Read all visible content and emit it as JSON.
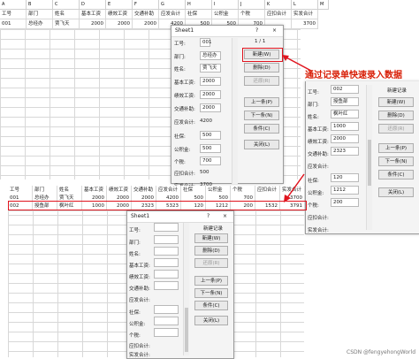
{
  "top_sheet": {
    "columns": [
      "A",
      "B",
      "C",
      "D",
      "E",
      "F",
      "G",
      "H",
      "I",
      "J",
      "K",
      "L",
      "M"
    ],
    "headers": [
      "工号",
      "部门",
      "姓名",
      "基本工资",
      "绩效工资",
      "交通补助",
      "应发合计",
      "社保",
      "公积金",
      "个税",
      "应扣合计",
      "实发合计"
    ],
    "row1": [
      "001",
      "总经办",
      "贾飞天",
      "2000",
      "2000",
      "2000",
      "4200",
      "500",
      "500",
      "700",
      "",
      "3700"
    ]
  },
  "bottom_sheet": {
    "headers": [
      "工号",
      "部门",
      "姓名",
      "基本工资",
      "绩效工资",
      "交通补助",
      "应发合计",
      "社保",
      "公积金",
      "个税",
      "应扣合计",
      "实发合计"
    ],
    "row1": [
      "001",
      "总经办",
      "贾飞天",
      "2000",
      "2000",
      "2000",
      "4200",
      "500",
      "500",
      "700",
      "",
      "3700"
    ],
    "row2": [
      "002",
      "授鱼部",
      "枫叶红",
      "1000",
      "2000",
      "2323",
      "5323",
      "120",
      "1212",
      "200",
      "1532",
      "3791"
    ]
  },
  "dialog1": {
    "title": "Sheet1",
    "help": "?",
    "close": "×",
    "counter": "1 / 1",
    "fields": [
      {
        "label": "工号:",
        "value": "001"
      },
      {
        "label": "部门:",
        "value": "总经办"
      },
      {
        "label": "姓名:",
        "value": "贾飞天"
      },
      {
        "label": "基本工资:",
        "value": "2000"
      },
      {
        "label": "绩效工资:",
        "value": "2000"
      },
      {
        "label": "交通补助:",
        "value": "2000"
      },
      {
        "label": "应发合计:",
        "value": "4200"
      },
      {
        "label": "社保:",
        "value": "500"
      },
      {
        "label": "公积金:",
        "value": "500"
      },
      {
        "label": "个税:",
        "value": "700"
      },
      {
        "label": "应扣合计:",
        "value": "500"
      },
      {
        "label": "实发合计:",
        "value": "3700"
      }
    ],
    "buttons": [
      "新建(W)",
      "删除(D)",
      "还原(R)",
      "上一条(P)",
      "下一条(N)",
      "条件(C)",
      "关闭(L)"
    ]
  },
  "dialog2": {
    "counter": "新建记录",
    "fields": [
      {
        "label": "工号:",
        "value": "002"
      },
      {
        "label": "部门:",
        "value": "授鱼部"
      },
      {
        "label": "姓名:",
        "value": "枫叶红"
      },
      {
        "label": "基本工资:",
        "value": "1000"
      },
      {
        "label": "绩效工资:",
        "value": "2000"
      },
      {
        "label": "交通补助:",
        "value": "2323"
      },
      {
        "label": "应发合计:",
        "value": ""
      },
      {
        "label": "社保:",
        "value": "120"
      },
      {
        "label": "公积金:",
        "value": "1212"
      },
      {
        "label": "个税:",
        "value": "200"
      },
      {
        "label": "应扣合计:",
        "value": ""
      },
      {
        "label": "实发合计:",
        "value": ""
      }
    ],
    "buttons": [
      "新建(W)",
      "删除(D)",
      "还原(R)",
      "上一条(P)",
      "下一条(N)",
      "条件(C)",
      "关闭(L)"
    ]
  },
  "dialog3": {
    "title": "Sheet1",
    "help": "?",
    "close": "×",
    "counter": "新建记录",
    "fields": [
      {
        "label": "工号:",
        "value": ""
      },
      {
        "label": "部门:",
        "value": ""
      },
      {
        "label": "姓名:",
        "value": ""
      },
      {
        "label": "基本工资:",
        "value": ""
      },
      {
        "label": "绩效工资:",
        "value": ""
      },
      {
        "label": "交通补助:",
        "value": ""
      },
      {
        "label": "应发合计:",
        "value": ""
      },
      {
        "label": "社保:",
        "value": ""
      },
      {
        "label": "公积金:",
        "value": ""
      },
      {
        "label": "个税:",
        "value": ""
      },
      {
        "label": "应扣合计:",
        "value": ""
      },
      {
        "label": "实发合计:",
        "value": ""
      }
    ],
    "buttons": [
      "新建(W)",
      "删除(D)",
      "还原(R)",
      "上一条(P)",
      "下一条(N)",
      "条件(C)",
      "关闭(L)"
    ]
  },
  "callout_text": "通过记录单快速录入数据",
  "watermark": "CSDN @fengyehongWorld",
  "colors": {
    "accent_red": "#e0141e",
    "callout_red": "#d81e06"
  }
}
